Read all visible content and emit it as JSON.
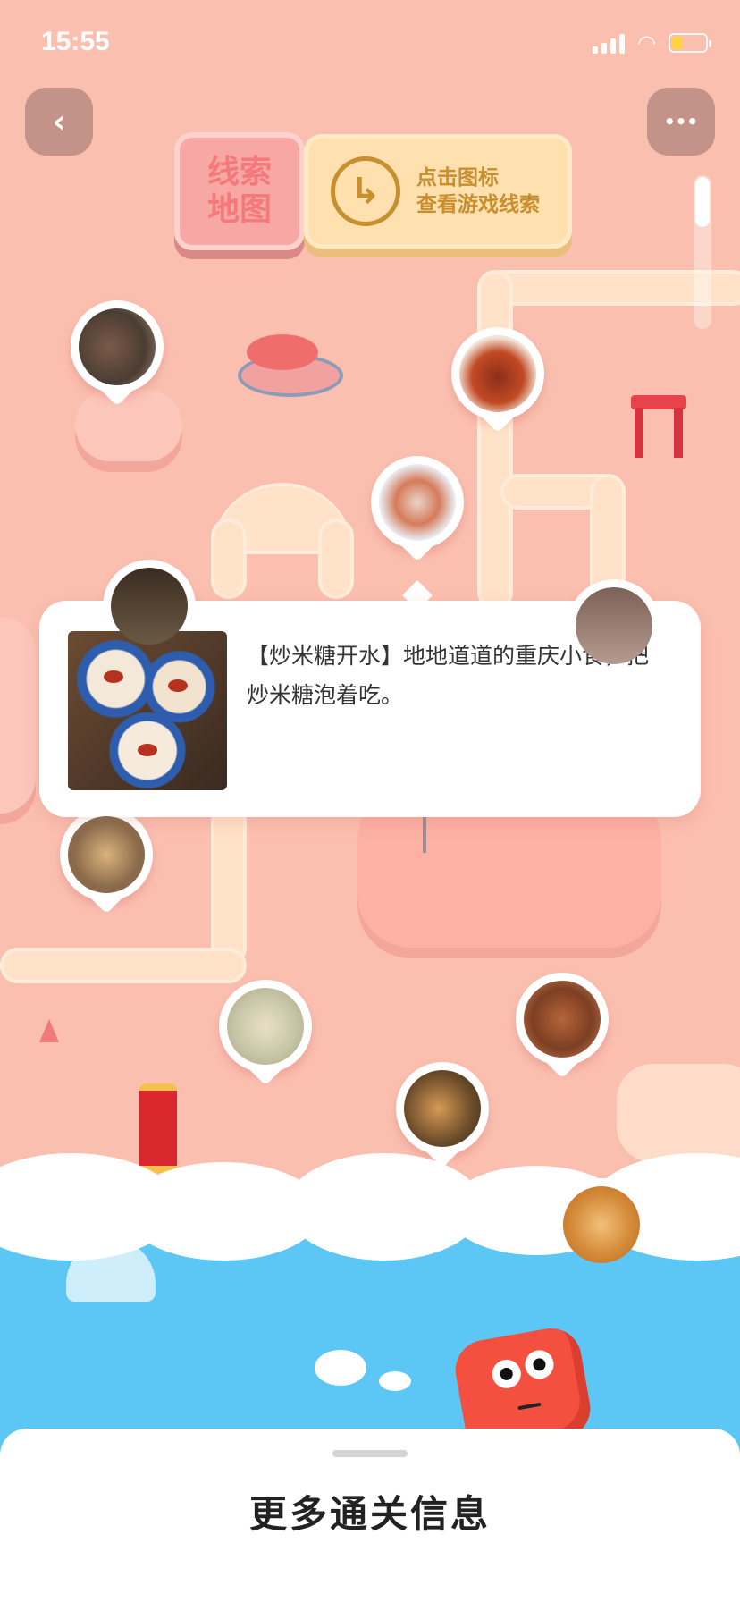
{
  "status_bar": {
    "time": "15:55"
  },
  "nav": {
    "back_icon": "‹",
    "more_icon": "•••"
  },
  "sign": {
    "left_line1": "线索",
    "left_line2": "地图",
    "right_line1": "点击图标",
    "right_line2": "查看游戏线索",
    "arrow_icon": "↳"
  },
  "popup": {
    "text": "【炒米糖开水】地地道道的重庆小食，把炒米糖泡着吃。"
  },
  "bottom_sheet": {
    "title": "更多通关信息"
  },
  "colors": {
    "background": "#FBBFB0",
    "road": "#FFE2C8",
    "sky": "#5CC6F5",
    "accent": "#C98E2E"
  }
}
